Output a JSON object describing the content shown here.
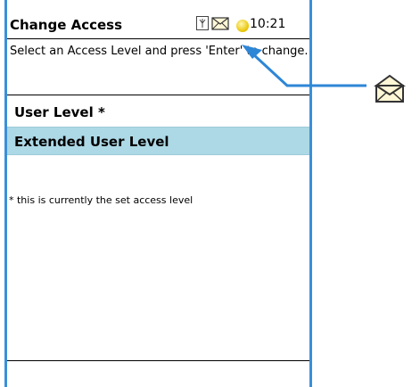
{
  "header": {
    "title": "Change Access",
    "time": "10:21",
    "icons": [
      "antenna-icon",
      "mail-icon",
      "battery-icon"
    ]
  },
  "instruction": "Select an Access Level and press 'Enter' to change.",
  "options": [
    {
      "label": "User Level *",
      "selected": false
    },
    {
      "label": "Extended User Level",
      "selected": true
    }
  ],
  "footnote": "* this is currently the set access level",
  "colors": {
    "selection": "#add8e6",
    "frame": "#3a8fd8",
    "callout": "#2e86d6"
  },
  "callout_icon": "envelope-icon"
}
